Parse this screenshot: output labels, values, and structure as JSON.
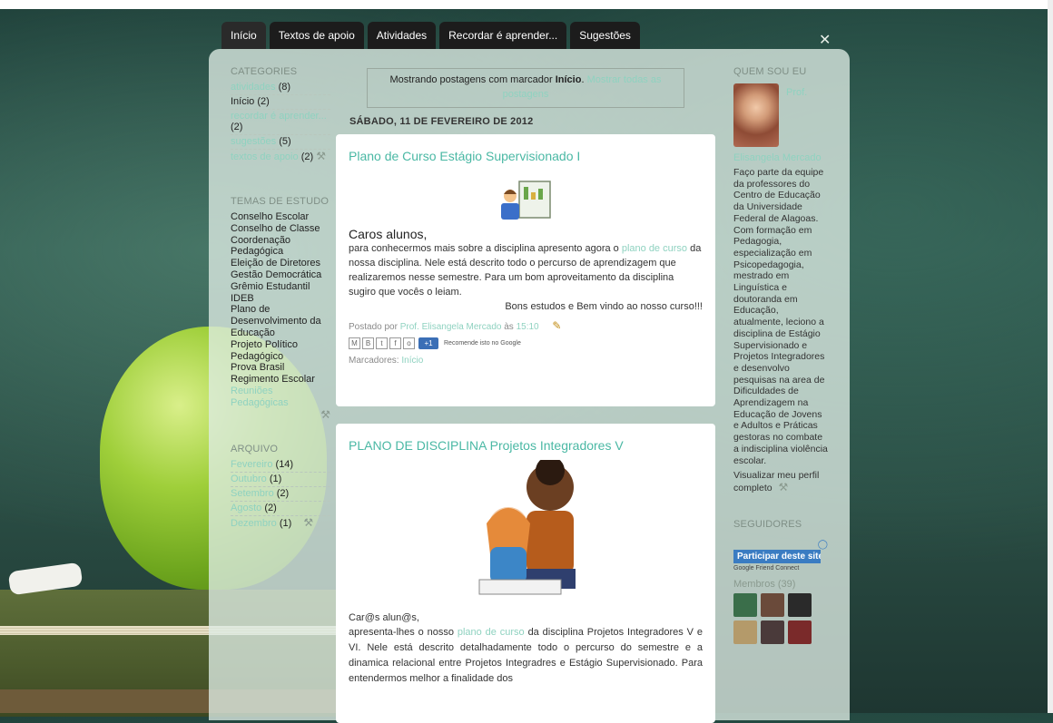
{
  "nav": {
    "tabs": [
      "Início",
      "Textos de apoio",
      "Atividades",
      "Recordar é aprender...",
      "Sugestões"
    ]
  },
  "left": {
    "categories_title": "CATEGORIES",
    "categories": [
      {
        "label": "atividades",
        "count": "(8)",
        "link": true
      },
      {
        "label": "Início",
        "count": "(2)",
        "link": false
      },
      {
        "label": "recordar é aprender...",
        "count": "(2)",
        "link": true
      },
      {
        "label": "sugestões",
        "count": "(5)",
        "link": true
      },
      {
        "label": "textos de apoio",
        "count": "(2)",
        "link": true
      }
    ],
    "temas_title": "TEMAS DE ESTUDO",
    "temas": [
      "Conselho Escolar",
      "Conselho de Classe",
      "Coordenação Pedagógica",
      "Eleição de Diretores",
      "Gestão Democrática",
      "Grêmio Estudantil",
      "IDEB",
      "Plano de Desenvolvimento da Educação",
      "Projeto Político Pedagógico",
      "Prova Brasil",
      "Regimento Escolar"
    ],
    "temas_link": "Reuniões Pedagógicas",
    "arquivo_title": "ARQUIVO",
    "arquivo": [
      {
        "label": "Fevereiro",
        "count": "(14)"
      },
      {
        "label": "Outubro",
        "count": "(1)"
      },
      {
        "label": "Setembro",
        "count": "(2)"
      },
      {
        "label": "Agosto",
        "count": "(2)"
      },
      {
        "label": "Dezembro",
        "count": "(1)"
      }
    ]
  },
  "filter": {
    "prefix": "Mostrando postagens com marcador ",
    "label": "Início",
    "suffix": ".",
    "show_all": "Mostrar todas as postagens"
  },
  "date_header": "SÁBADO, 11 DE FEVEREIRO DE 2012",
  "post1": {
    "title": "Plano de Curso Estágio Supervisionado I",
    "greeting": "Caros alunos,",
    "body_a": "para conhecermos mais sobre a disciplina apresento agora o ",
    "body_link": "plano de curso",
    "body_b": " da nossa disciplina. Nele está descrito todo o percurso de aprendizagem que realizaremos nesse semestre. Para um bom aproveitamento da disciplina sugiro que vocês o leiam.",
    "closing": "Bons estudos e Bem vindo ao nosso curso!!!",
    "posted_by": "Postado por ",
    "author": "Prof. Elisangela Mercado",
    "at": " às ",
    "time": "15:10",
    "recommend": "Recomende isto no Google",
    "labels_prefix": "Marcadores: ",
    "label": "Início"
  },
  "post2": {
    "title": "PLANO DE DISCIPLINA Projetos Integradores V",
    "greeting": "Car@s alun@s,",
    "body_a": "apresenta-lhes o nosso ",
    "body_link": "plano de curso",
    "body_b": " da disciplina Projetos Integradores V e VI. Nele está descrito detalhadamente todo o percurso do semestre e a dinamica relacional entre Projetos Integradres e Estágio Supervisionado. Para entendermos melhor a finalidade dos"
  },
  "right": {
    "about_title": "QUEM SOU EU",
    "name_a": "Prof.",
    "name_b": "Elisangela Mercado",
    "bio": "Faço parte da equipe da professores do Centro de Educação da Universidade Federal de Alagoas. Com formação em Pedagogia, especialização em Psicopedagogia, mestrado em Linguística e doutoranda em Educação, atualmente, leciono a disciplina de Estágio Supervisionado e Projetos Integradores e desenvolvo pesquisas na area de Dificuldades de Aprendizagem na Educação de Jovens e Adultos e Práticas gestoras no combate a indisciplina violência escolar.",
    "profile_link": "Visualizar meu perfil completo",
    "followers_title": "SEGUIDORES",
    "follow_btn": "Participar deste site",
    "gfc": "Google Friend Connect",
    "members": "Membros (39)"
  }
}
